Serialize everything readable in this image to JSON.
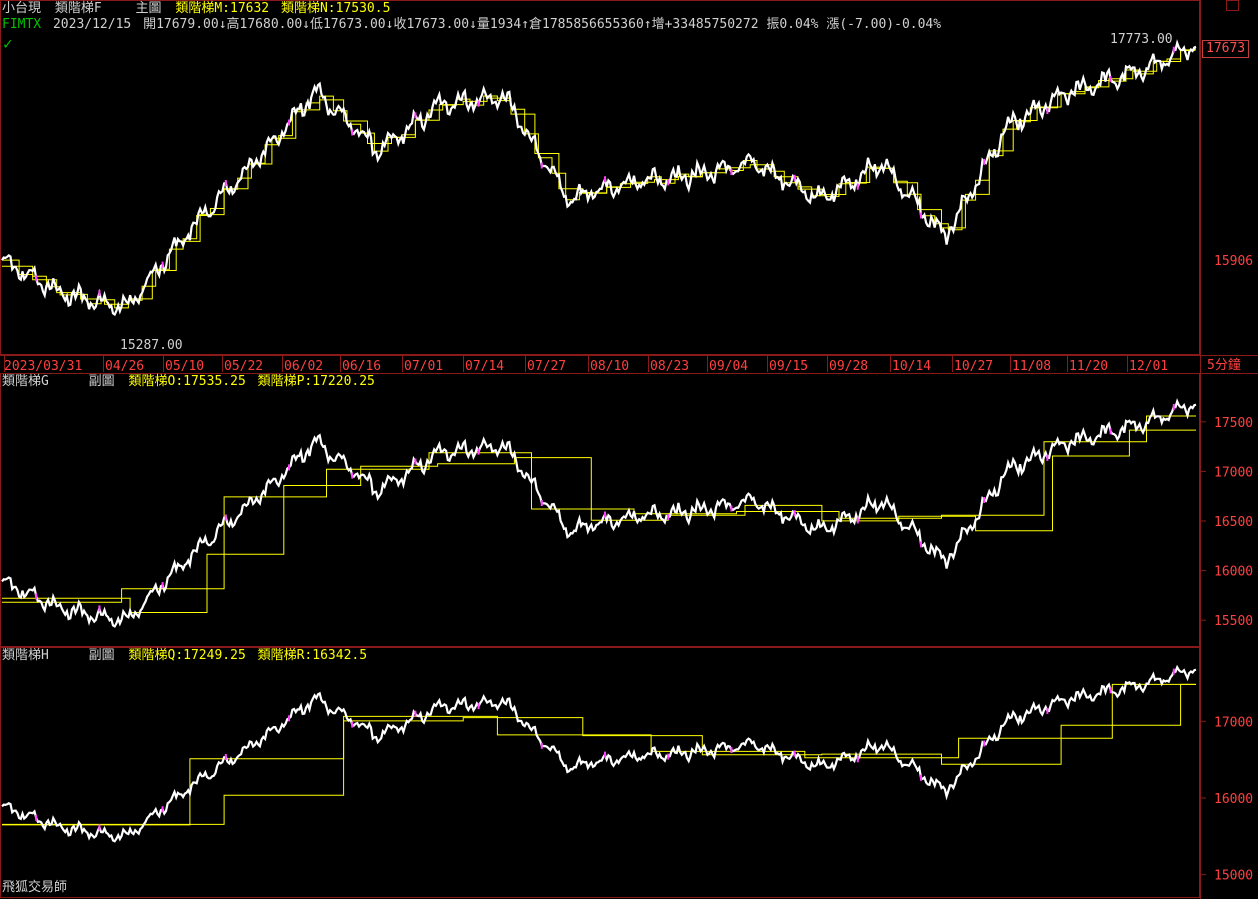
{
  "header": {
    "instrument": "小台現",
    "main_indicator": "類階梯F",
    "main_label": "主圖",
    "ind_m": "類階梯M:17632",
    "ind_n": "類階梯N:17530.5",
    "symbol": "FIMTX",
    "date": "2023/12/15",
    "open": "開17679.00",
    "high": "高17680.00",
    "low": "低17673.00",
    "close": "收17673.00",
    "volume": "量1934",
    "oi": "倉1785856655360",
    "oi_change": "增+33485750272",
    "amplitude": "振0.04%",
    "change": "漲(-7.00)-0.04%",
    "check_icon": "check-icon"
  },
  "main_panel": {
    "high_label": "17773.00",
    "low_label": "15287.00",
    "last_price_tag": "17673",
    "axis_label": "15906",
    "period": "5分鐘",
    "dates": [
      "2023/03/31",
      "04/26",
      "05/10",
      "05/22",
      "06/02",
      "06/16",
      "07/01",
      "07/14",
      "07/27",
      "08/10",
      "08/23",
      "09/04",
      "09/15",
      "09/28",
      "10/14",
      "10/27",
      "11/08",
      "11/20",
      "12/01"
    ]
  },
  "sub1": {
    "name": "類階梯G",
    "label": "副圖",
    "ind_o": "類階梯O:17535.25",
    "ind_p": "類階梯P:17220.25",
    "y_labels": [
      "17500",
      "17000",
      "16500",
      "16000",
      "15500"
    ]
  },
  "sub2": {
    "name": "類階梯H",
    "label": "副圖",
    "ind_q": "類階梯Q:17249.25",
    "ind_r": "類階梯R:16342.5",
    "y_labels": [
      "17000",
      "16000",
      "15000"
    ]
  },
  "footer": {
    "watermark": "飛狐交易師"
  },
  "chart_data": {
    "type": "line",
    "x": [
      "2023/03/31",
      "04/26",
      "05/10",
      "05/22",
      "06/02",
      "06/16",
      "07/01",
      "07/14",
      "07/27",
      "08/10",
      "08/23",
      "09/04",
      "09/15",
      "09/28",
      "10/14",
      "10/27",
      "11/08",
      "11/20",
      "12/01",
      "12/15"
    ],
    "series": [
      {
        "name": "小台現",
        "color": "#ffffff",
        "values": [
          15880,
          15600,
          15500,
          16150,
          16700,
          17300,
          16800,
          17200,
          17250,
          16400,
          16550,
          16600,
          16700,
          16400,
          16700,
          16080,
          17000,
          17300,
          17450,
          17673
        ]
      }
    ],
    "step_series_main": [
      {
        "name": "類階梯M",
        "color": "#ffff00",
        "last": 17632
      },
      {
        "name": "類階梯N",
        "color": "#ffff00",
        "last": 17530.5
      }
    ],
    "sub1_series": [
      {
        "name": "類階梯O",
        "color": "#ffff00",
        "last": 17535.25
      },
      {
        "name": "類階梯P",
        "color": "#ffff00",
        "last": 17220.25
      }
    ],
    "sub2_series": [
      {
        "name": "類階梯Q",
        "color": "#ffff00",
        "last": 17249.25
      },
      {
        "name": "類階梯R",
        "color": "#ffff00",
        "last": 16342.5
      }
    ],
    "high": 17773.0,
    "low": 15287.0,
    "sub1_ylim": [
      15300,
      17800
    ],
    "sub2_ylim": [
      14800,
      17800
    ]
  }
}
